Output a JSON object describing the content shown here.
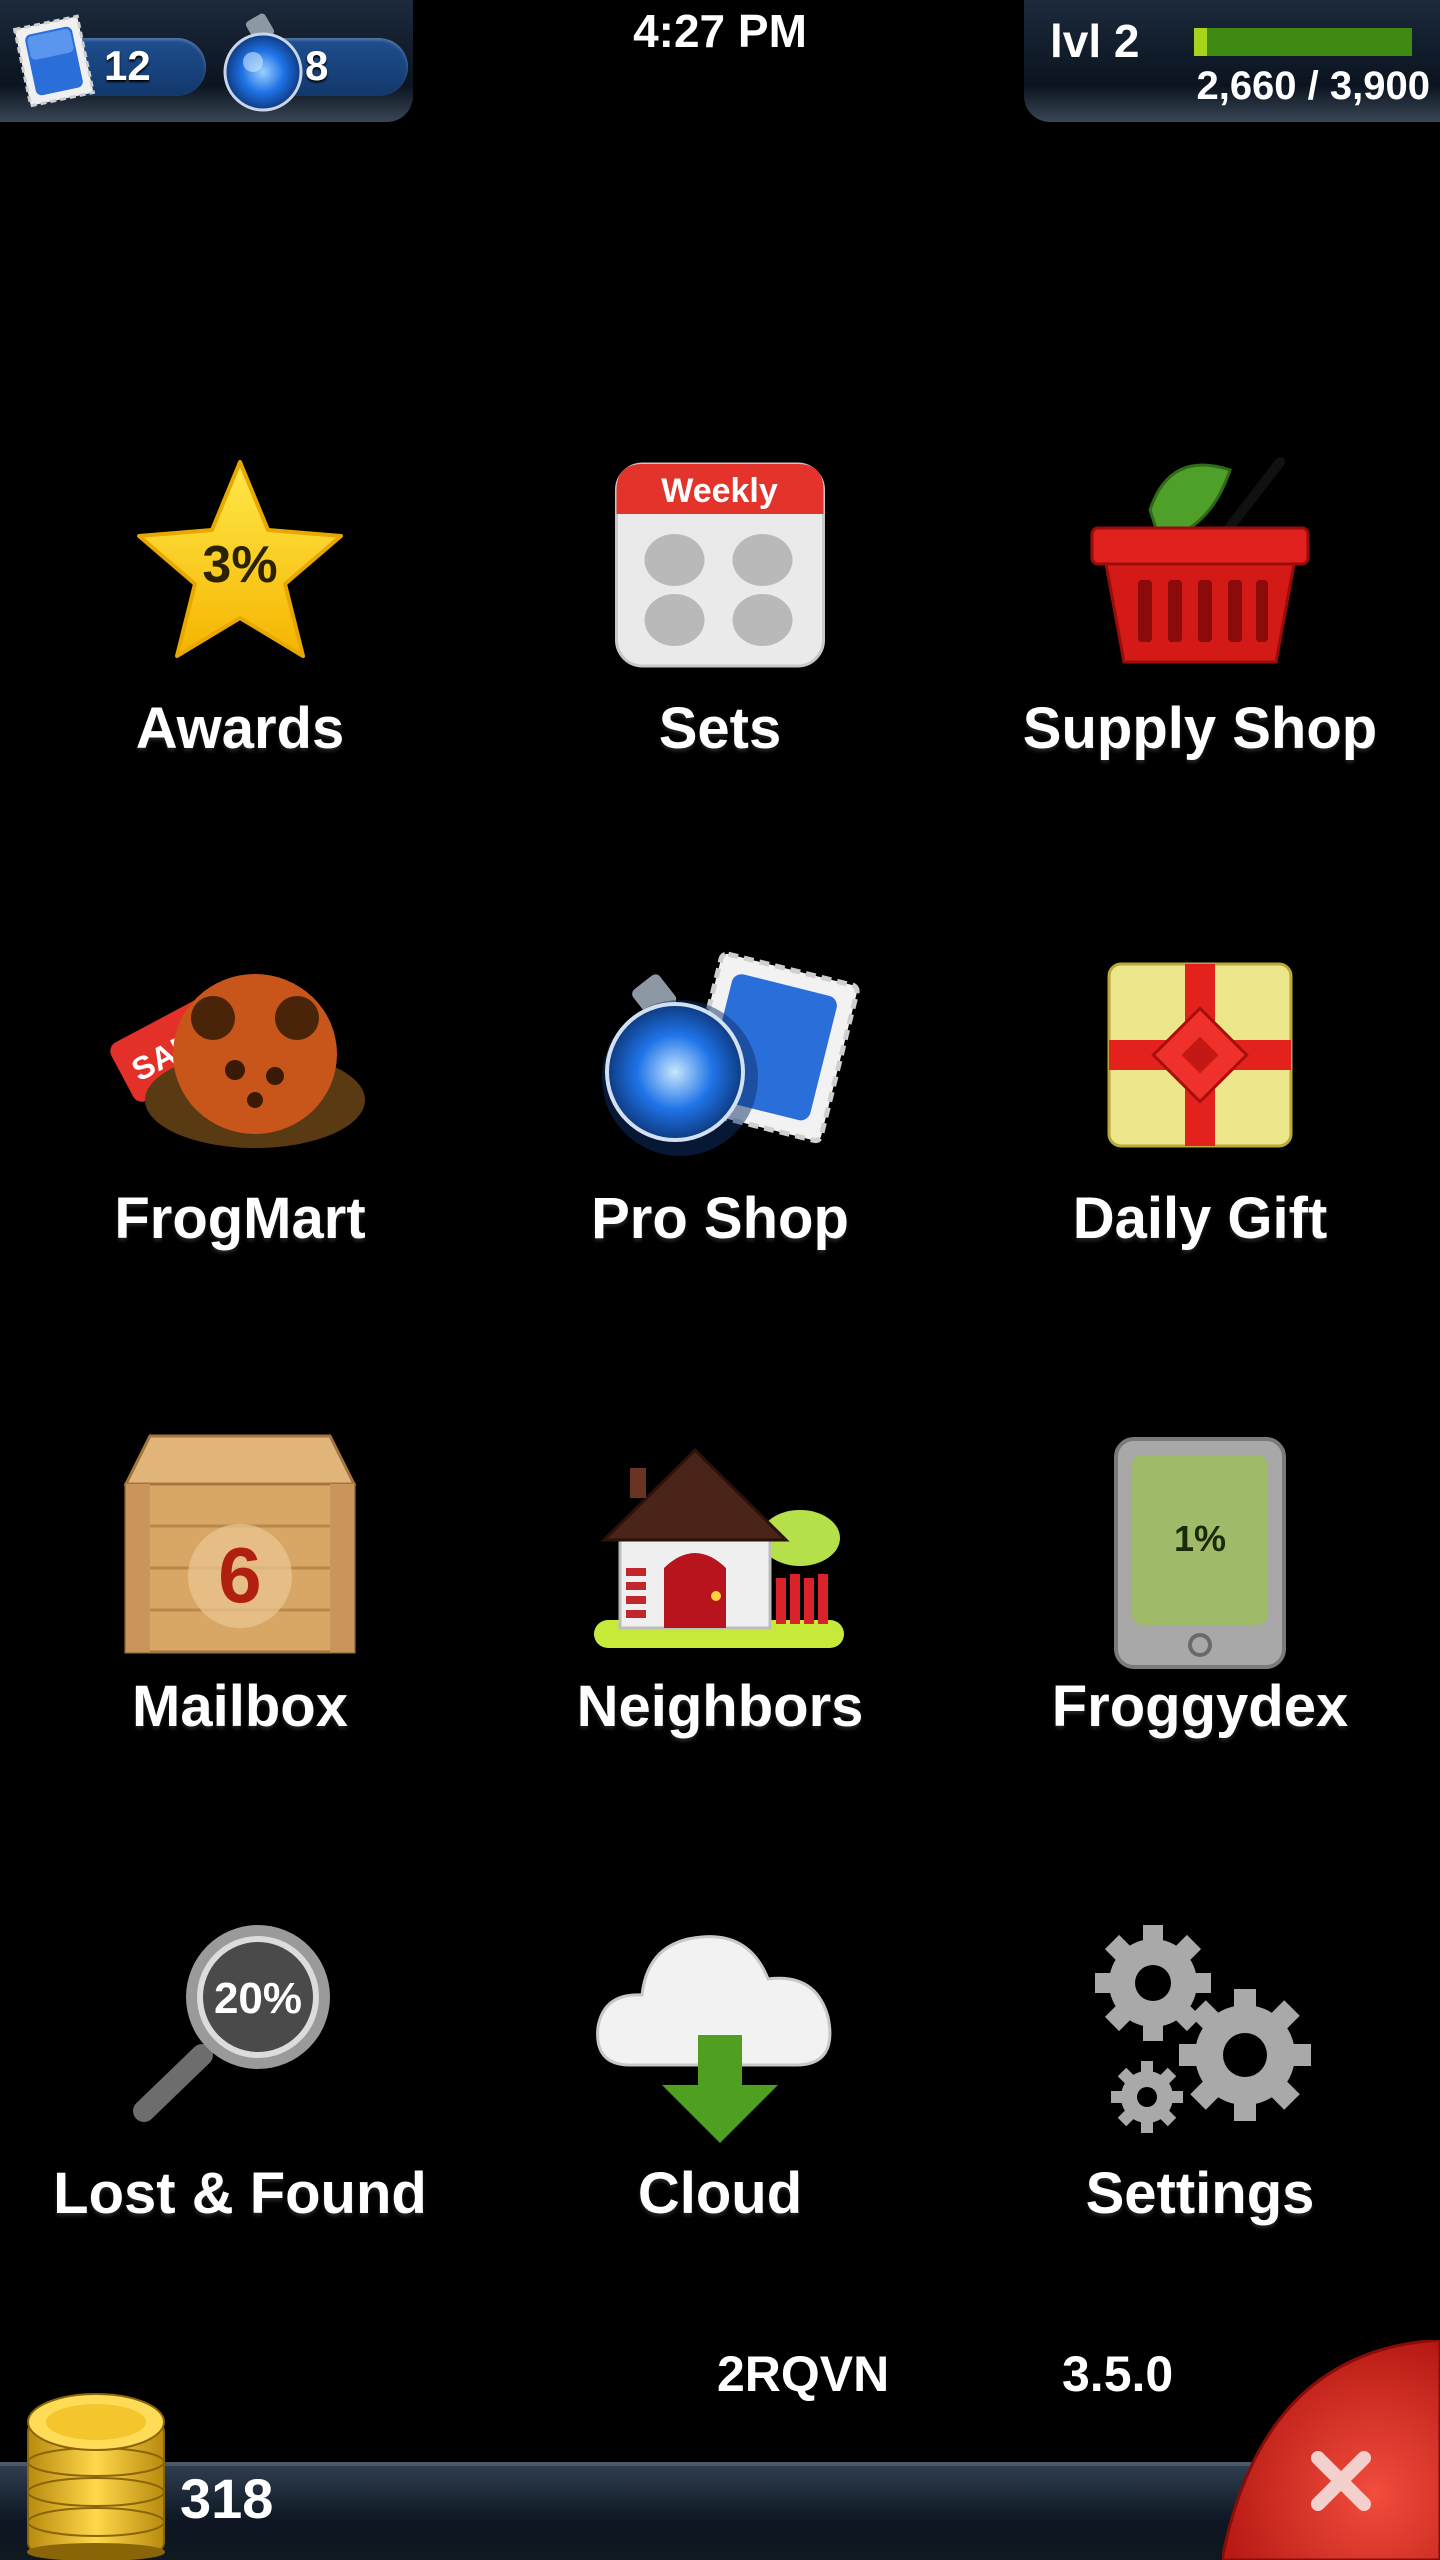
{
  "status": {
    "time": "4:27 PM",
    "stamps": "12",
    "potions": "8",
    "level_label": "lvl 2",
    "xp_text": "2,660 / 3,900",
    "xp_progress": 0.06
  },
  "menu": {
    "items": [
      {
        "label": "Awards",
        "icon": "star-icon",
        "badge": "3%"
      },
      {
        "label": "Sets",
        "icon": "weekly-calendar-icon",
        "badge": "Weekly"
      },
      {
        "label": "Supply Shop",
        "icon": "basket-icon"
      },
      {
        "label": "FrogMart",
        "icon": "frog-sale-icon",
        "badge": "SALE"
      },
      {
        "label": "Pro Shop",
        "icon": "potion-stamp-icon"
      },
      {
        "label": "Daily Gift",
        "icon": "gift-icon"
      },
      {
        "label": "Mailbox",
        "icon": "crate-icon",
        "badge": "6"
      },
      {
        "label": "Neighbors",
        "icon": "house-icon"
      },
      {
        "label": "Froggydex",
        "icon": "device-icon",
        "badge": "1%"
      },
      {
        "label": "Lost & Found",
        "icon": "magnifier-icon",
        "badge": "20%"
      },
      {
        "label": "Cloud",
        "icon": "cloud-download-icon"
      },
      {
        "label": "Settings",
        "icon": "gears-icon"
      }
    ]
  },
  "footer": {
    "code": "2RQVN",
    "version": "3.5.0",
    "coins": "318"
  },
  "colors": {
    "background": "#000000",
    "xp_bar": "#a5d41b",
    "pill_blue": "#1f4f8f",
    "close_red": "#d42a2a"
  }
}
